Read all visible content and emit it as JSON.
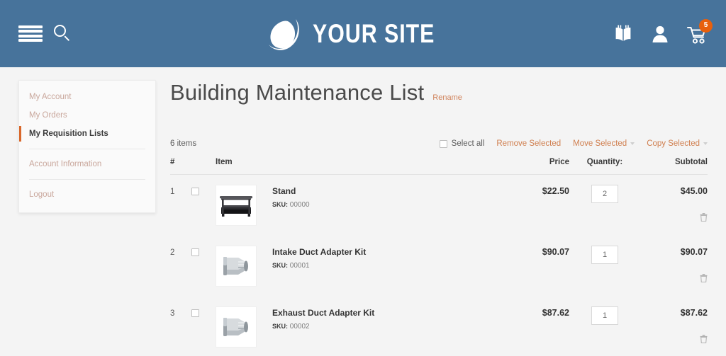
{
  "header": {
    "menu_icon": "hamburger-menu-icon",
    "search_icon": "search-icon",
    "brand_name": "YOUR SITE",
    "logo_icon": "droplet-logo-icon",
    "right_icons": [
      {
        "name": "gift-registry-icon",
        "label": "Gift Registry"
      },
      {
        "name": "user-account-icon",
        "label": "My Account"
      },
      {
        "name": "shopping-cart-icon",
        "label": "Cart"
      }
    ],
    "cart_count": "5",
    "background_color": "#47739b",
    "accent_color": "#e8600c"
  },
  "sidebar": {
    "items": [
      {
        "label": "My Account",
        "active": false
      },
      {
        "label": "My Orders",
        "active": false
      },
      {
        "label": "My Requisition Lists",
        "active": true
      },
      {
        "label": "Account Information",
        "active": false
      },
      {
        "label": "Logout",
        "active": false
      }
    ]
  },
  "main": {
    "title": "Building Maintenance List",
    "rename_label": "Rename",
    "item_count": "6 items",
    "toolbar": {
      "select_all_label": "Select all",
      "remove_selected_label": "Remove Selected",
      "move_selected_label": "Move Selected",
      "copy_selected_label": "Copy Selected"
    },
    "table": {
      "headers": {
        "num": "#",
        "item": "Item",
        "price": "Price",
        "quantity": "Quantity:",
        "subtotal": "Subtotal"
      },
      "rows": [
        {
          "num": "1",
          "name": "Stand",
          "sku_label": "SKU:",
          "sku_value": "00000",
          "price": "$22.50",
          "qty": "2",
          "subtotal": "$45.00",
          "thumb": "tv-stand-photo",
          "remove_icon": "trash-icon"
        },
        {
          "num": "2",
          "name": "Intake Duct Adapter Kit",
          "sku_label": "SKU:",
          "sku_value": "00001",
          "price": "$90.07",
          "qty": "1",
          "subtotal": "$90.07",
          "thumb": "duct-adapter-photo",
          "remove_icon": "trash-icon"
        },
        {
          "num": "3",
          "name": "Exhaust Duct Adapter Kit",
          "sku_label": "SKU:",
          "sku_value": "00002",
          "price": "$87.62",
          "qty": "1",
          "subtotal": "$87.62",
          "thumb": "duct-adapter-photo",
          "remove_icon": "trash-icon"
        }
      ]
    }
  },
  "colors": {
    "header_blue": "#47739b",
    "link_orange": "#d07f4f",
    "badge_orange": "#e8600c",
    "active_border": "#d9682b",
    "page_bg": "#f4f4f4"
  }
}
